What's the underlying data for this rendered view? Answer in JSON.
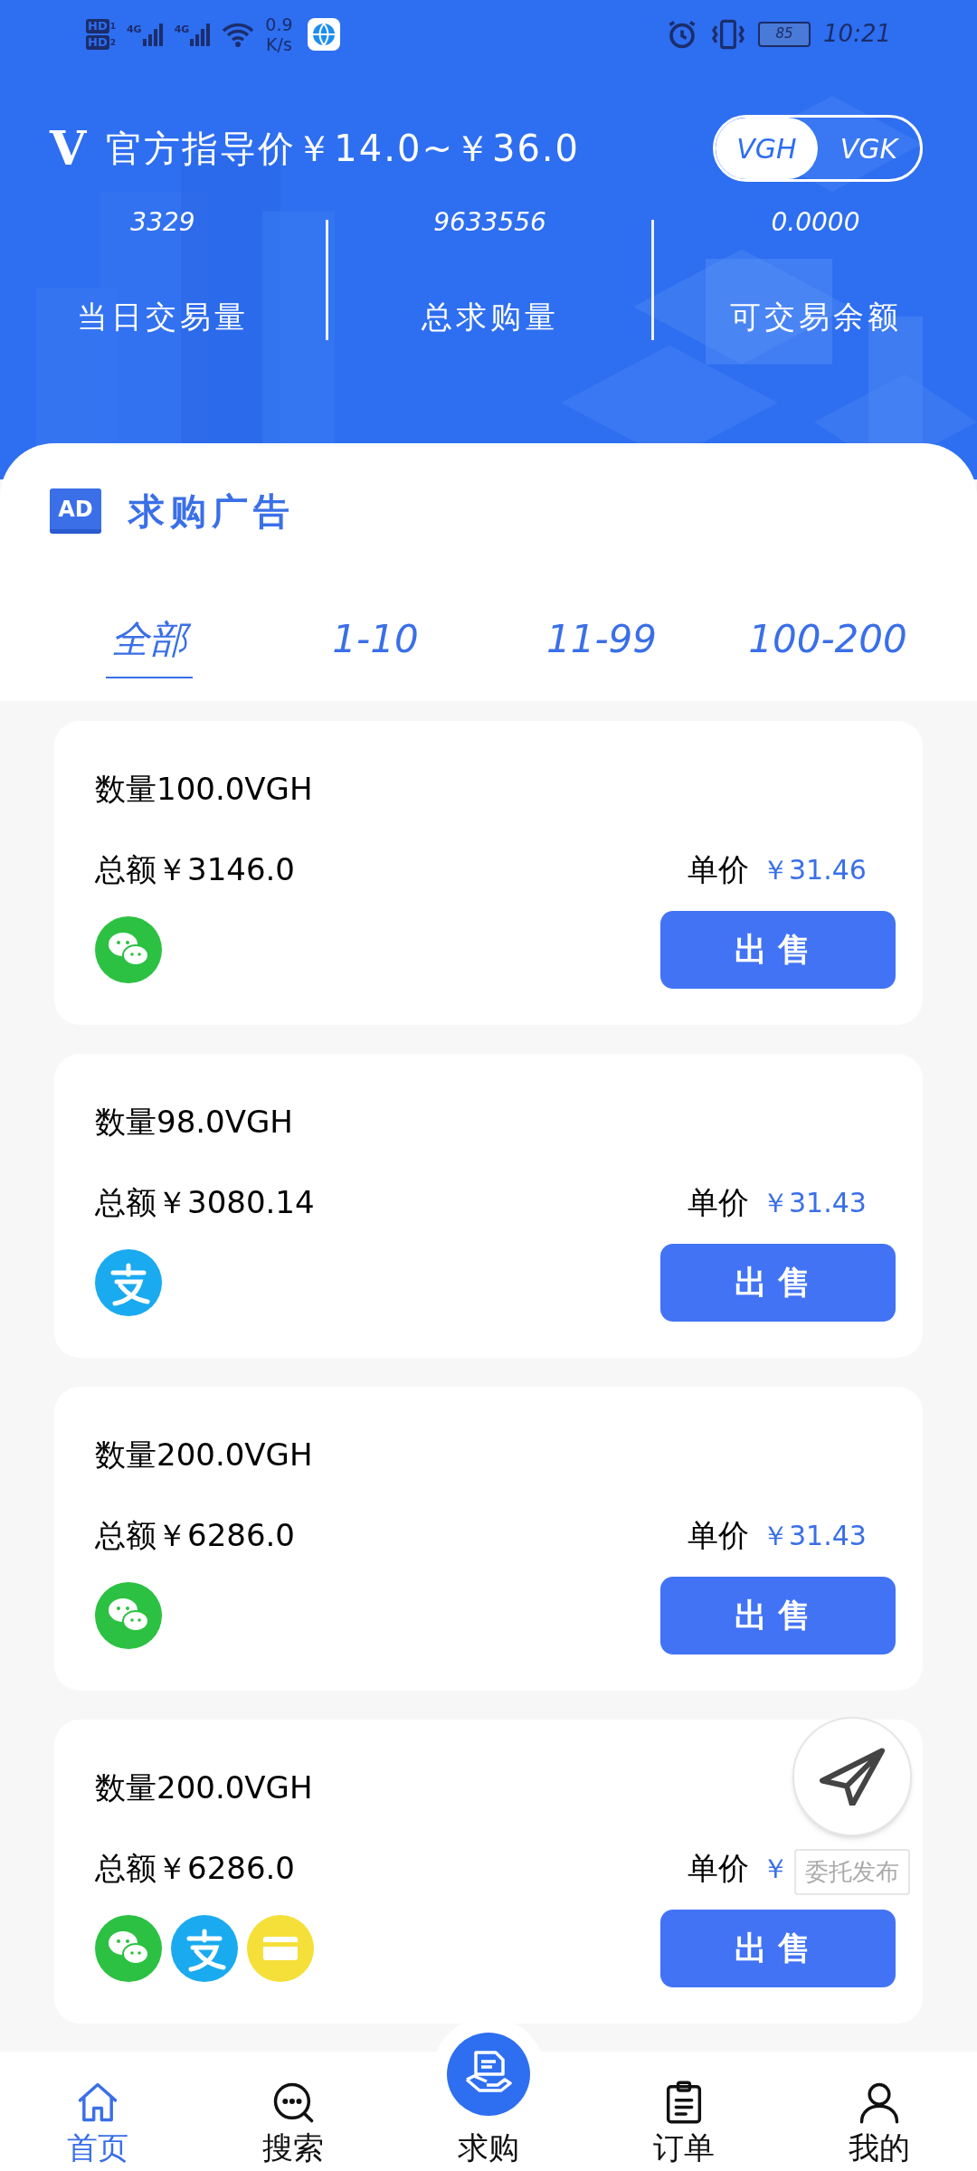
{
  "status_bar": {
    "sims": [
      "HD",
      "HD"
    ],
    "sim_slots": [
      "1",
      "2"
    ],
    "networks": [
      "4G",
      "4G"
    ],
    "speed": "0.9",
    "speed_unit": "K/s",
    "battery": "85",
    "time": "10:21"
  },
  "header": {
    "logo": "V",
    "title": "官方指导价￥14.0~￥36.0",
    "coins": [
      {
        "label": "VGH",
        "selected": true
      },
      {
        "label": "VGK",
        "selected": false
      }
    ],
    "stats": [
      {
        "value": "3329",
        "label": "当日交易量"
      },
      {
        "value": "9633556",
        "label": "总求购量"
      },
      {
        "value": "0.0000",
        "label": "可交易余额"
      }
    ]
  },
  "section": {
    "badge": "AD",
    "title": "求购广告"
  },
  "tabs": [
    {
      "label": "全部",
      "selected": true
    },
    {
      "label": "1-10",
      "selected": false
    },
    {
      "label": "11-99",
      "selected": false
    },
    {
      "label": "100-200",
      "selected": false
    }
  ],
  "ads": [
    {
      "quantity": "数量100.0VGH",
      "total": "总额￥3146.0",
      "price_label": "单价",
      "price": "￥31.46",
      "payments": [
        {
          "kind": "wechat"
        }
      ],
      "button": "出售"
    },
    {
      "quantity": "数量98.0VGH",
      "total": "总额￥3080.14",
      "price_label": "单价",
      "price": "￥31.43",
      "payments": [
        {
          "kind": "alipay"
        }
      ],
      "button": "出售"
    },
    {
      "quantity": "数量200.0VGH",
      "total": "总额￥6286.0",
      "price_label": "单价",
      "price": "￥31.43",
      "payments": [
        {
          "kind": "wechat"
        }
      ],
      "button": "出售"
    },
    {
      "quantity": "数量200.0VGH",
      "total": "总额￥6286.0",
      "price_label": "单价",
      "price": "￥",
      "payments": [
        {
          "kind": "wechat"
        },
        {
          "kind": "alipay"
        },
        {
          "kind": "card"
        }
      ],
      "button": "出售"
    }
  ],
  "fab": {
    "label": "委托发布"
  },
  "bottom_nav": [
    {
      "label": "首页",
      "kind": "home",
      "selected": true
    },
    {
      "label": "搜索",
      "kind": "search",
      "selected": false
    },
    {
      "label": "求购",
      "kind": "buy",
      "selected": false
    },
    {
      "label": "订单",
      "kind": "orders",
      "selected": false
    },
    {
      "label": "我的",
      "kind": "profile",
      "selected": false
    }
  ]
}
